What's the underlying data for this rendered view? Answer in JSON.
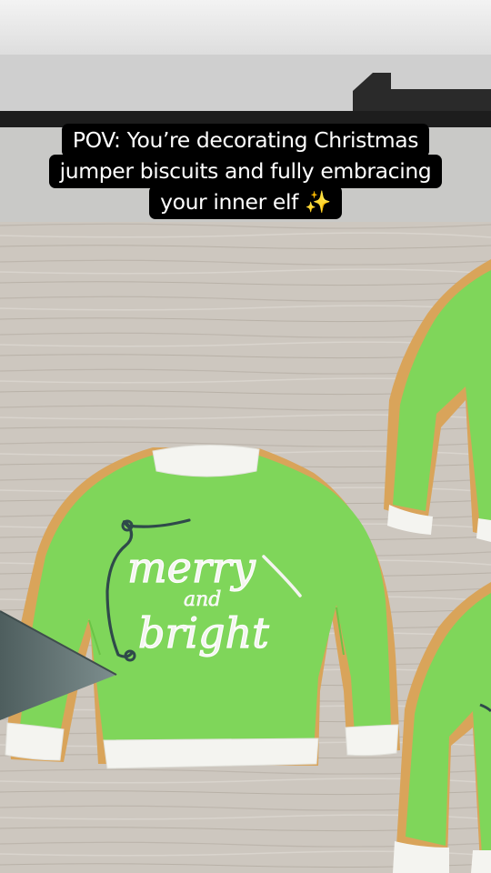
{
  "caption": {
    "line1": "POV: You’re decorating Christmas",
    "line2": "jumper biscuits and fully embracing",
    "line3": "your inner elf",
    "emoji": "✨"
  },
  "cookie_text": {
    "word1": "merry",
    "word2": "and",
    "word3": "bright"
  },
  "colors": {
    "icing_green": "#7fd65a",
    "icing_white": "#f4f4f0",
    "biscuit": "#d9a45a",
    "wood": "#cfc9c1",
    "outline_dark": "#2f4a4a",
    "caption_bg": "#000000"
  }
}
